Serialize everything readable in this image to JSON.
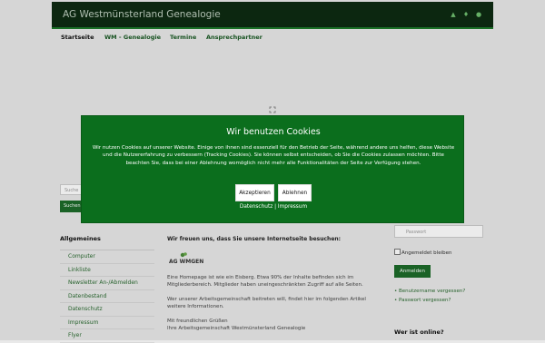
{
  "header": {
    "title": "AG Westmünsterland Genealogie"
  },
  "nav": {
    "items": [
      "Startseite",
      "WM - Genealogie",
      "Termine",
      "Ansprechpartner"
    ]
  },
  "search": {
    "placeholder": "Suche",
    "button": "Suchen"
  },
  "menu": {
    "title": "Allgemeines",
    "items": [
      "Computer",
      "Linkliste",
      "Newsletter An-/Abmelden",
      "Datenbestand",
      "Datenschutz",
      "Impressum",
      "Flyer"
    ]
  },
  "main": {
    "heading": "Wir freuen uns, dass Sie unsere Internetseite besuchen:",
    "logo_text": "AG WMGEN",
    "para1": "Eine Homepage ist wie ein Eisberg. Etwa 90% der Inhalte befinden sich im Mitgliederbereich. Mitglieder haben uneingeschränkten Zugriff auf alle Seiten.",
    "para2": "Wer unserer Arbeitsgemeinschaft beitreten will, findet hier im folgenden Artikel weitere Informationen.",
    "greeting1": "Mit freundlichen Grüßen",
    "greeting2": "Ihre Arbeitsgemeinschaft Westmünsterland Genealogie"
  },
  "login": {
    "password_placeholder": "Passwort",
    "remember": "Angemeldet bleiben",
    "button": "Anmelden",
    "forgot_username": "Benutzername vergessen?",
    "forgot_password": "Passwort vergessen?",
    "online_title": "Wer ist online?"
  },
  "cookie": {
    "title": "Wir benutzen Cookies",
    "text": "Wir nutzen Cookies auf unserer Website. Einige von ihnen sind essenziell für den Betrieb der Seite, während andere uns helfen, diese Website und die Nutzererfahrung zu verbessern (Tracking Cookies). Sie können selbst entscheiden, ob Sie die Cookies zulassen möchten. Bitte beachten Sie, dass bei einer Ablehnung womöglich nicht mehr alle Funktionalitäten der Seite zur Verfügung stehen.",
    "accept": "Akzeptieren",
    "decline": "Ablehnen",
    "privacy": "Datenschutz",
    "separator": "|",
    "imprint": "Impressum"
  },
  "colors": {
    "accent": "#0b6e1d",
    "header_bg": "#0e2b12",
    "link": "#2a6a30"
  }
}
